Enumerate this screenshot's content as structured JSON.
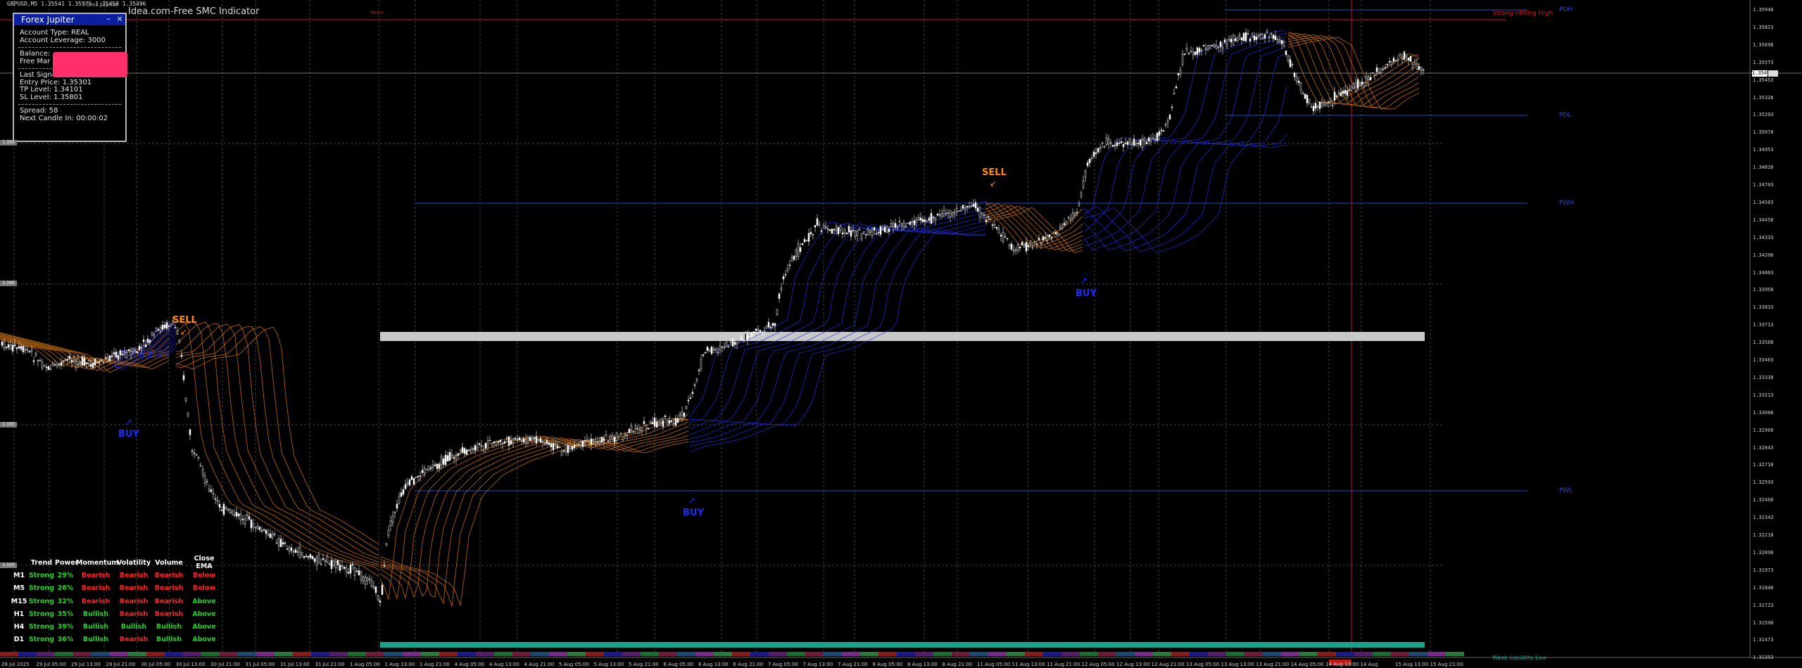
{
  "window": {
    "symbol_quote": "GBPUSD,M5 1.35541 1.35575 1.35458 1.35496",
    "indicator_prefix": "Forex Jupiter",
    "indicator_name": "Idea.com-Free SMC Indicator",
    "brand_watermark": "Forex"
  },
  "panel": {
    "title": "Forex Jupiter",
    "minimize": "–",
    "close": "×",
    "account_type": "Account Type: REAL",
    "leverage": "Account Leverage: 3000",
    "balance": "Balance:",
    "free_margin": "Free Mar",
    "last_signal": "Last Signal: Sell",
    "entry_price": "Entry Price: 1.35301",
    "tp_level": "TP Level: 1.34101",
    "sl_level": "SL Level: 1.35801",
    "spread": "Spread: 58",
    "next_candle": "Next Candle In: 00:00:02"
  },
  "levels": {
    "pdh": "PDH",
    "pdl": "PDL",
    "pwh": "PWH",
    "pwl": "PWL",
    "strong_high": "Strong Hitting High",
    "weak_low": "Weak Liquidity Low"
  },
  "signals": [
    {
      "label": "SELL",
      "type": "sell"
    },
    {
      "label": "BUY",
      "type": "buy"
    },
    {
      "label": "BUY",
      "type": "buy"
    },
    {
      "label": "SELL",
      "type": "sell"
    },
    {
      "label": "BUY",
      "type": "buy"
    }
  ],
  "price_axis": {
    "current_price": "1.35496",
    "labels": [
      "1.35948",
      "1.35823",
      "1.35698",
      "1.35573",
      "1.35453",
      "1.35328",
      "1.35203",
      "1.35078",
      "1.34953",
      "1.34828",
      "1.34703",
      "1.34583",
      "1.34458",
      "1.34333",
      "1.34208",
      "1.34083",
      "1.33958",
      "1.33833",
      "1.33713",
      "1.33588",
      "1.33463",
      "1.33338",
      "1.33213",
      "1.33088",
      "1.32968",
      "1.32843",
      "1.32718",
      "1.32593",
      "1.32468",
      "1.32343",
      "1.32218",
      "1.32098",
      "1.31973",
      "1.31848",
      "1.31723",
      "1.31598",
      "1.31473",
      "1.31353"
    ]
  },
  "left_axis_labels": [
    "1.350",
    "1.340",
    "1.330",
    "1.320"
  ],
  "time_axis": [
    "28 Jul 2025",
    "29 Jul 05:00",
    "29 Jul 13:00",
    "29 Jul 21:00",
    "30 Jul 05:00",
    "30 Jul 13:00",
    "30 Jul 21:00",
    "31 Jul 05:00",
    "31 Jul 13:00",
    "31 Jul 21:00",
    "1 Aug 05:00",
    "1 Aug 13:00",
    "1 Aug 21:00",
    "4 Aug 05:00",
    "4 Aug 13:00",
    "4 Aug 21:00",
    "5 Aug 05:00",
    "5 Aug 13:00",
    "5 Aug 21:00",
    "6 Aug 05:00",
    "6 Aug 13:00",
    "6 Aug 21:00",
    "7 Aug 05:00",
    "7 Aug 13:00",
    "7 Aug 21:00",
    "8 Aug 05:00",
    "8 Aug 13:00",
    "8 Aug 21:00",
    "11 Aug 05:00",
    "11 Aug 13:00",
    "11 Aug 21:00",
    "12 Aug 05:00",
    "12 Aug 13:00",
    "12 Aug 21:00",
    "13 Aug 05:00",
    "13 Aug 13:00",
    "13 Aug 21:00",
    "14 Aug 05:00",
    "14 Aug 13:00",
    "14 Aug",
    "15 Aug 13:00",
    "15 Aug 21:00"
  ],
  "mtf_table": {
    "headers": [
      "",
      "Trend",
      "Power",
      "Momentum",
      "Volatility",
      "Volume",
      "Close EMA"
    ],
    "rows": [
      [
        "M1",
        "Strong",
        "29%",
        "Bearish",
        "Bearish",
        "Bearish",
        "Below"
      ],
      [
        "M5",
        "Strong",
        "26%",
        "Bearish",
        "Bearish",
        "Bearish",
        "Below"
      ],
      [
        "M15",
        "Strong",
        "32%",
        "Bearish",
        "Bearish",
        "Bearish",
        "Above"
      ],
      [
        "H1",
        "Strong",
        "35%",
        "Bullish",
        "Bearish",
        "Bearish",
        "Above"
      ],
      [
        "H4",
        "Strong",
        "39%",
        "Bullish",
        "Bullish",
        "Bullish",
        "Above"
      ],
      [
        "D1",
        "Strong",
        "36%",
        "Bullish",
        "Bearish",
        "Bullish",
        "Above"
      ]
    ]
  },
  "colors": {
    "bull": "#22d322",
    "bear": "#ff2323",
    "buy": "#1a2cff",
    "sell": "#ff8a00",
    "ribbon_bull": "#1d2fe0",
    "ribbon_bear": "#e07b10",
    "zone_supply": "#c8c8c8",
    "zone_bottom": "#1aa38a",
    "level_line": "#2748c4",
    "high_line": "#c41919"
  }
}
